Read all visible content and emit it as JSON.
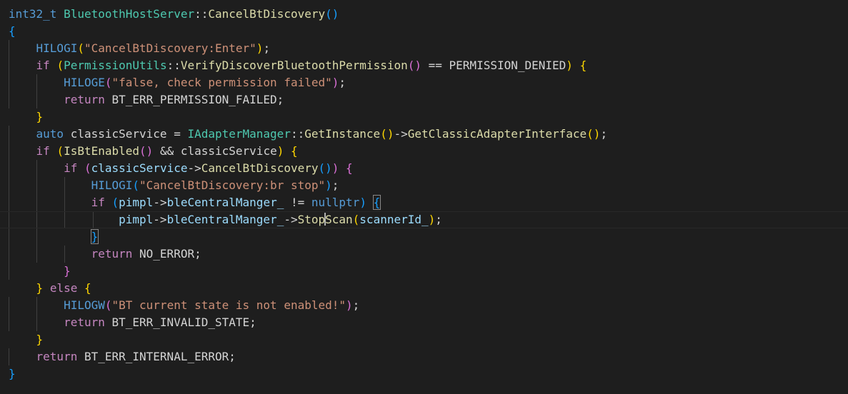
{
  "editor": {
    "theme_colors": {
      "background": "#1e1e1e",
      "keyword": "#569cd6",
      "control": "#c586c0",
      "type": "#4ec9b0",
      "function": "#dcdcaa",
      "string": "#ce9178",
      "variable": "#9cdcfe",
      "text": "#d4d4d4",
      "bracket_level1": "#ffd700",
      "bracket_level2": "#da70d6",
      "bracket_level3": "#179fff"
    },
    "lines": [
      {
        "text": "int32_t BluetoothHostServer::CancelBtDiscovery()",
        "tokens": [
          {
            "t": "int32_t",
            "c": "kw"
          },
          {
            "t": " ",
            "c": "plain"
          },
          {
            "t": "BluetoothHostServer",
            "c": "type"
          },
          {
            "t": "::",
            "c": "plain"
          },
          {
            "t": "CancelBtDiscovery",
            "c": "fn"
          },
          {
            "t": "()",
            "c": "b3"
          }
        ]
      },
      {
        "text": "{",
        "tokens": [
          {
            "t": "{",
            "c": "b3"
          }
        ]
      },
      {
        "text": "    HILOGI(\"CancelBtDiscovery:Enter\");",
        "tokens": [
          {
            "t": "    ",
            "c": "plain"
          },
          {
            "t": "HILOGI",
            "c": "macro"
          },
          {
            "t": "(",
            "c": "b1"
          },
          {
            "t": "\"CancelBtDiscovery:Enter\"",
            "c": "str"
          },
          {
            "t": ")",
            "c": "b1"
          },
          {
            "t": ";",
            "c": "plain"
          }
        ]
      },
      {
        "text": "    if (PermissionUtils::VerifyDiscoverBluetoothPermission() == PERMISSION_DENIED) {",
        "tokens": [
          {
            "t": "    ",
            "c": "plain"
          },
          {
            "t": "if",
            "c": "ctrl"
          },
          {
            "t": " ",
            "c": "plain"
          },
          {
            "t": "(",
            "c": "b1"
          },
          {
            "t": "PermissionUtils",
            "c": "type"
          },
          {
            "t": "::",
            "c": "plain"
          },
          {
            "t": "VerifyDiscoverBluetoothPermission",
            "c": "fn"
          },
          {
            "t": "()",
            "c": "b2"
          },
          {
            "t": " == PERMISSION_DENIED",
            "c": "plain"
          },
          {
            "t": ")",
            "c": "b1"
          },
          {
            "t": " ",
            "c": "plain"
          },
          {
            "t": "{",
            "c": "b1"
          }
        ]
      },
      {
        "text": "        HILOGE(\"false, check permission failed\");",
        "tokens": [
          {
            "t": "        ",
            "c": "plain"
          },
          {
            "t": "HILOGE",
            "c": "macro"
          },
          {
            "t": "(",
            "c": "b2"
          },
          {
            "t": "\"false, check permission failed\"",
            "c": "str"
          },
          {
            "t": ")",
            "c": "b2"
          },
          {
            "t": ";",
            "c": "plain"
          }
        ]
      },
      {
        "text": "        return BT_ERR_PERMISSION_FAILED;",
        "tokens": [
          {
            "t": "        ",
            "c": "plain"
          },
          {
            "t": "return",
            "c": "ctrl"
          },
          {
            "t": " BT_ERR_PERMISSION_FAILED;",
            "c": "plain"
          }
        ]
      },
      {
        "text": "    }",
        "tokens": [
          {
            "t": "    ",
            "c": "plain"
          },
          {
            "t": "}",
            "c": "b1"
          }
        ]
      },
      {
        "text": "    auto classicService = IAdapterManager::GetInstance()->GetClassicAdapterInterface();",
        "tokens": [
          {
            "t": "    ",
            "c": "plain"
          },
          {
            "t": "auto",
            "c": "kw"
          },
          {
            "t": " classicService = ",
            "c": "plain"
          },
          {
            "t": "IAdapterManager",
            "c": "type"
          },
          {
            "t": "::",
            "c": "plain"
          },
          {
            "t": "GetInstance",
            "c": "fn"
          },
          {
            "t": "()",
            "c": "b1"
          },
          {
            "t": "->",
            "c": "plain"
          },
          {
            "t": "GetClassicAdapterInterface",
            "c": "fn"
          },
          {
            "t": "()",
            "c": "b1"
          },
          {
            "t": ";",
            "c": "plain"
          }
        ]
      },
      {
        "text": "    if (IsBtEnabled() && classicService) {",
        "tokens": [
          {
            "t": "    ",
            "c": "plain"
          },
          {
            "t": "if",
            "c": "ctrl"
          },
          {
            "t": " ",
            "c": "plain"
          },
          {
            "t": "(",
            "c": "b1"
          },
          {
            "t": "IsBtEnabled",
            "c": "fn"
          },
          {
            "t": "()",
            "c": "b2"
          },
          {
            "t": " && classicService",
            "c": "plain"
          },
          {
            "t": ")",
            "c": "b1"
          },
          {
            "t": " ",
            "c": "plain"
          },
          {
            "t": "{",
            "c": "b1"
          }
        ]
      },
      {
        "text": "        if (classicService->CancelBtDiscovery()) {",
        "tokens": [
          {
            "t": "        ",
            "c": "plain"
          },
          {
            "t": "if",
            "c": "ctrl"
          },
          {
            "t": " ",
            "c": "plain"
          },
          {
            "t": "(",
            "c": "b2"
          },
          {
            "t": "classicService",
            "c": "var"
          },
          {
            "t": "->",
            "c": "plain"
          },
          {
            "t": "CancelBtDiscovery",
            "c": "fn"
          },
          {
            "t": "()",
            "c": "b3"
          },
          {
            "t": ")",
            "c": "b2"
          },
          {
            "t": " ",
            "c": "plain"
          },
          {
            "t": "{",
            "c": "b2"
          }
        ]
      },
      {
        "text": "            HILOGI(\"CancelBtDiscovery:br stop\");",
        "tokens": [
          {
            "t": "            ",
            "c": "plain"
          },
          {
            "t": "HILOGI",
            "c": "macro"
          },
          {
            "t": "(",
            "c": "b3"
          },
          {
            "t": "\"CancelBtDiscovery:br stop\"",
            "c": "str"
          },
          {
            "t": ")",
            "c": "b3"
          },
          {
            "t": ";",
            "c": "plain"
          }
        ]
      },
      {
        "text": "            if (pimpl->bleCentralManger_ != nullptr) {",
        "tokens": [
          {
            "t": "            ",
            "c": "plain"
          },
          {
            "t": "if",
            "c": "ctrl"
          },
          {
            "t": " ",
            "c": "plain"
          },
          {
            "t": "(",
            "c": "b3"
          },
          {
            "t": "pimpl",
            "c": "var"
          },
          {
            "t": "->",
            "c": "plain"
          },
          {
            "t": "bleCentralManger_",
            "c": "var"
          },
          {
            "t": " != ",
            "c": "plain"
          },
          {
            "t": "nullptr",
            "c": "kw"
          },
          {
            "t": ")",
            "c": "b3"
          },
          {
            "t": " ",
            "c": "plain"
          },
          {
            "t": "{",
            "c": "b3",
            "match": true
          }
        ]
      },
      {
        "text": "                pimpl->bleCentralManger_->StopScan(scannerId_);",
        "current": true,
        "tokens": [
          {
            "t": "                ",
            "c": "plain"
          },
          {
            "t": "pimpl",
            "c": "var"
          },
          {
            "t": "->",
            "c": "plain"
          },
          {
            "t": "bleCentralManger_",
            "c": "var"
          },
          {
            "t": "->",
            "c": "plain"
          },
          {
            "t": "Stop",
            "c": "fn"
          },
          {
            "t": "|",
            "c": "cursor"
          },
          {
            "t": "Scan",
            "c": "fn"
          },
          {
            "t": "(",
            "c": "b1"
          },
          {
            "t": "scannerId_",
            "c": "var"
          },
          {
            "t": ")",
            "c": "b1"
          },
          {
            "t": ";",
            "c": "plain"
          }
        ]
      },
      {
        "text": "            }",
        "tokens": [
          {
            "t": "            ",
            "c": "plain"
          },
          {
            "t": "}",
            "c": "b3",
            "match": true
          }
        ]
      },
      {
        "text": "            return NO_ERROR;",
        "tokens": [
          {
            "t": "            ",
            "c": "plain"
          },
          {
            "t": "return",
            "c": "ctrl"
          },
          {
            "t": " NO_ERROR;",
            "c": "plain"
          }
        ]
      },
      {
        "text": "        }",
        "tokens": [
          {
            "t": "        ",
            "c": "plain"
          },
          {
            "t": "}",
            "c": "b2"
          }
        ]
      },
      {
        "text": "    } else {",
        "tokens": [
          {
            "t": "    ",
            "c": "plain"
          },
          {
            "t": "}",
            "c": "b1"
          },
          {
            "t": " ",
            "c": "plain"
          },
          {
            "t": "else",
            "c": "ctrl"
          },
          {
            "t": " ",
            "c": "plain"
          },
          {
            "t": "{",
            "c": "b1"
          }
        ]
      },
      {
        "text": "        HILOGW(\"BT current state is not enabled!\");",
        "tokens": [
          {
            "t": "        ",
            "c": "plain"
          },
          {
            "t": "HILOGW",
            "c": "macro"
          },
          {
            "t": "(",
            "c": "b2"
          },
          {
            "t": "\"BT current state is not enabled!\"",
            "c": "str"
          },
          {
            "t": ")",
            "c": "b2"
          },
          {
            "t": ";",
            "c": "plain"
          }
        ]
      },
      {
        "text": "        return BT_ERR_INVALID_STATE;",
        "tokens": [
          {
            "t": "        ",
            "c": "plain"
          },
          {
            "t": "return",
            "c": "ctrl"
          },
          {
            "t": " BT_ERR_INVALID_STATE;",
            "c": "plain"
          }
        ]
      },
      {
        "text": "    }",
        "tokens": [
          {
            "t": "    ",
            "c": "plain"
          },
          {
            "t": "}",
            "c": "b1"
          }
        ]
      },
      {
        "text": "    return BT_ERR_INTERNAL_ERROR;",
        "tokens": [
          {
            "t": "    ",
            "c": "plain"
          },
          {
            "t": "return",
            "c": "ctrl"
          },
          {
            "t": " BT_ERR_INTERNAL_ERROR;",
            "c": "plain"
          }
        ]
      },
      {
        "text": "}",
        "tokens": [
          {
            "t": "}",
            "c": "b3"
          }
        ]
      }
    ]
  }
}
